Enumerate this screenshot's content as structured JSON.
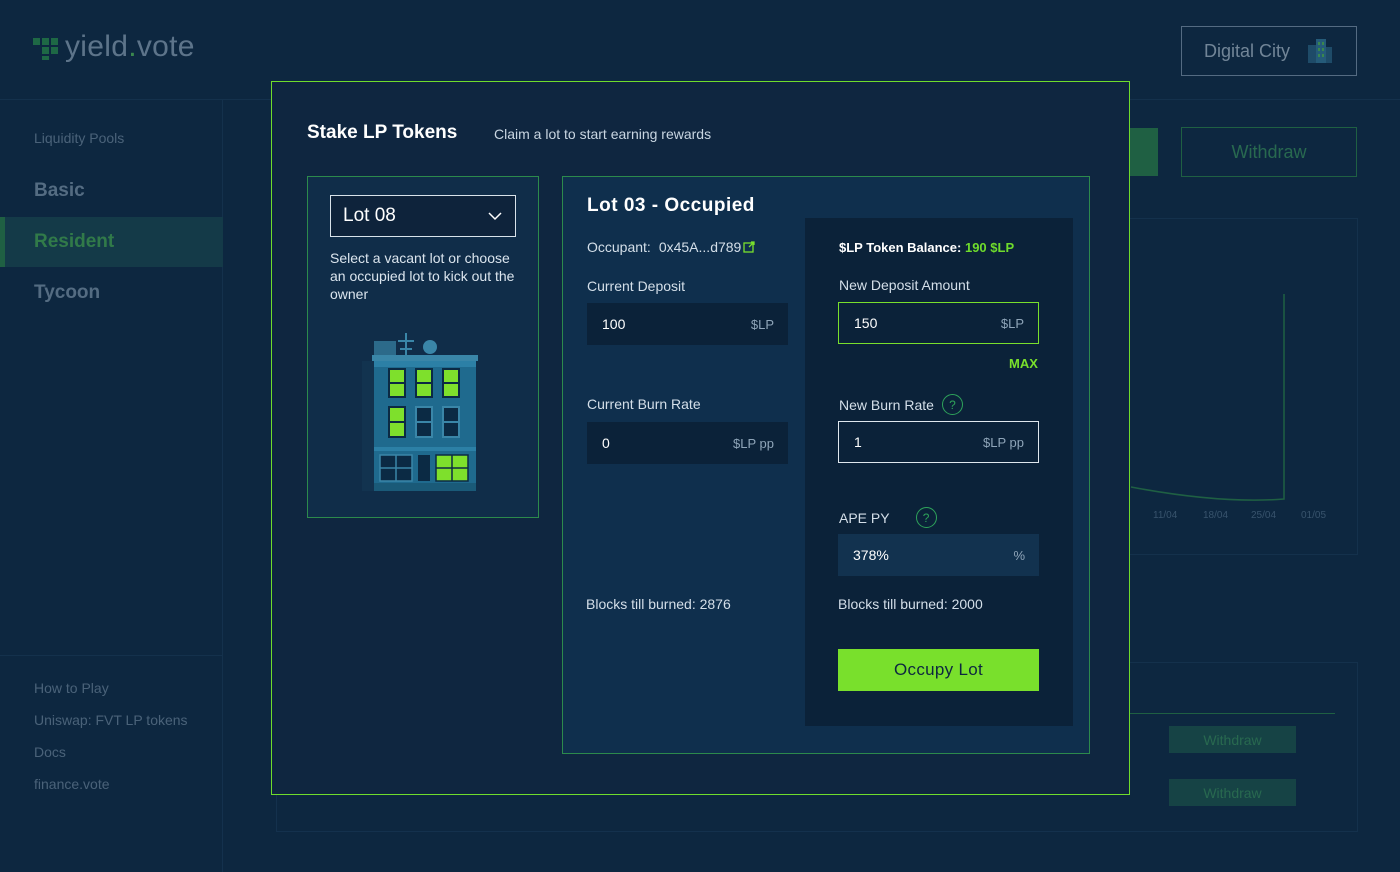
{
  "app": {
    "logo_text_a": "yield",
    "logo_text_dot": ".",
    "logo_text_b": "vote",
    "city_label": "Digital City"
  },
  "sidebar": {
    "section_title": "Liquidity Pools",
    "items": [
      {
        "label": "Basic"
      },
      {
        "label": "Resident"
      },
      {
        "label": "Tycoon"
      }
    ],
    "links": [
      {
        "label": "How to Play"
      },
      {
        "label": "Uniswap: FVT LP tokens"
      },
      {
        "label": "Docs"
      },
      {
        "label": "finance.vote"
      }
    ]
  },
  "background": {
    "withdraw_label": "Withdraw",
    "chart_ticks": [
      "11/04",
      "18/04",
      "25/04",
      "01/05"
    ],
    "table_withdraw": [
      "Withdraw",
      "Withdraw"
    ]
  },
  "modal": {
    "title": "Stake LP Tokens",
    "subtitle": "Claim a lot to start earning rewards",
    "lot_select_value": "Lot 08",
    "lot_help": "Select a vacant lot or choose an occupied lot to kick out the owner",
    "lot_title": "Lot 03 - Occupied",
    "occupant_label": "Occupant:",
    "occupant_value": "0x45A...d789",
    "current_deposit_label": "Current Deposit",
    "current_deposit_value": "100",
    "current_deposit_unit": "$LP",
    "current_burn_label": "Current Burn Rate",
    "current_burn_value": "0",
    "current_burn_unit": "$LP pp",
    "blocks_current": "Blocks till burned: 2876",
    "balance_label": "$LP Token Balance:",
    "balance_value": "190 $LP",
    "new_deposit_label": "New Deposit Amount",
    "new_deposit_value": "150",
    "new_deposit_unit": "$LP",
    "max_label": "MAX",
    "new_burn_label": "New Burn Rate",
    "new_burn_value": "1",
    "new_burn_unit": "$LP pp",
    "apepy_label": "APE PY",
    "apepy_value": "378%",
    "apepy_unit": "%",
    "blocks_new": "Blocks till burned: 2000",
    "occupy_label": "Occupy Lot",
    "help_glyph": "?"
  },
  "colors": {
    "accent": "#79e02c",
    "background": "#0d2740",
    "panel_border": "#2c8a4c"
  }
}
